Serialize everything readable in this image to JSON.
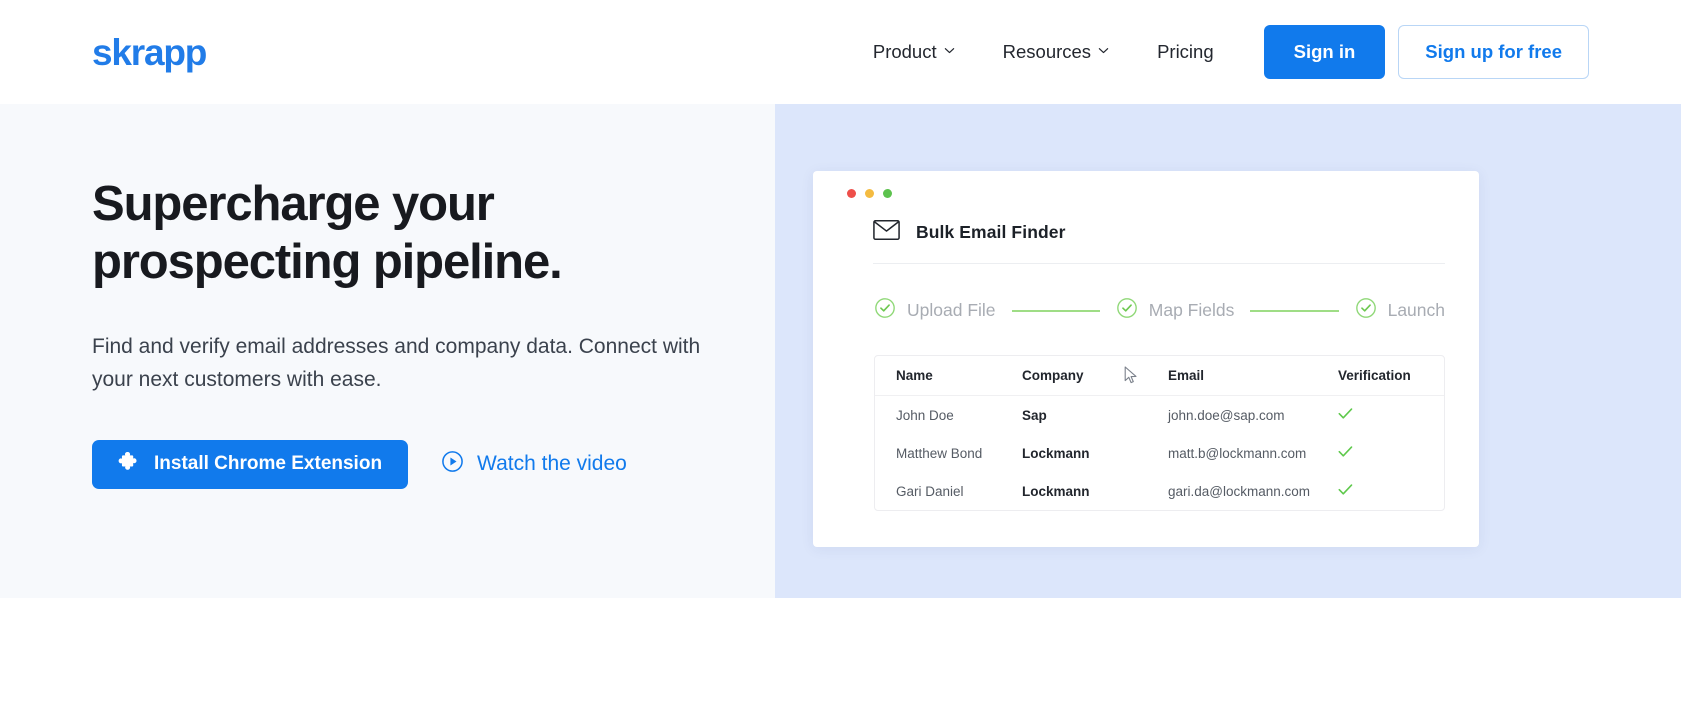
{
  "brand": {
    "logo_text": "skrapp",
    "accent_color": "#117aec",
    "logo_color": "#217ce8"
  },
  "header": {
    "nav_items": [
      {
        "label": "Product",
        "has_dropdown": true,
        "icon": "chevron-down-icon"
      },
      {
        "label": "Resources",
        "has_dropdown": true,
        "icon": "chevron-down-icon"
      },
      {
        "label": "Pricing",
        "has_dropdown": false,
        "icon": ""
      }
    ],
    "sign_in_label": "Sign in",
    "sign_up_label": "Sign up for free"
  },
  "hero": {
    "title": "Supercharge your prospecting pipeline.",
    "subtitle": "Find and verify email addresses and company data. Connect with your next customers with ease.",
    "primary_cta": {
      "label": "Install Chrome Extension",
      "icon": "puzzle-piece-icon"
    },
    "secondary_cta": {
      "label": "Watch the video",
      "icon": "play-circle-icon"
    },
    "left_bg": "#f7f9fc",
    "right_bg": "#dce6fb"
  },
  "mockup": {
    "window_dots": [
      {
        "name": "close-dot",
        "color": "#ee4f4a"
      },
      {
        "name": "minimize-dot",
        "color": "#f4bb41"
      },
      {
        "name": "maximize-dot",
        "color": "#5dc24e"
      }
    ],
    "title": "Bulk Email Finder",
    "title_icon": "envelope-icon",
    "steps": [
      {
        "label": "Upload File",
        "icon": "check-circle-icon",
        "done": true
      },
      {
        "label": "Map Fields",
        "icon": "check-circle-icon",
        "done": true
      },
      {
        "label": "Launch",
        "icon": "check-circle-icon",
        "done": true
      }
    ],
    "step_line_color": "#9fdd86",
    "table": {
      "columns": [
        "Name",
        "Company",
        "Email",
        "Verification"
      ],
      "rows": [
        {
          "name": "John Doe",
          "company": "Sap",
          "email": "john.doe@sap.com",
          "verification": "verified",
          "verification_icon": "check-icon"
        },
        {
          "name": "Matthew Bond",
          "company": "Lockmann",
          "email": "matt.b@lockmann.com",
          "verification": "verified",
          "verification_icon": "check-icon"
        },
        {
          "name": "Gari Daniel",
          "company": "Lockmann",
          "email": "gari.da@lockmann.com",
          "verification": "verified",
          "verification_icon": "check-icon"
        }
      ],
      "verified_color": "#5ec94b"
    },
    "cursor_icon": "mouse-pointer-icon"
  }
}
